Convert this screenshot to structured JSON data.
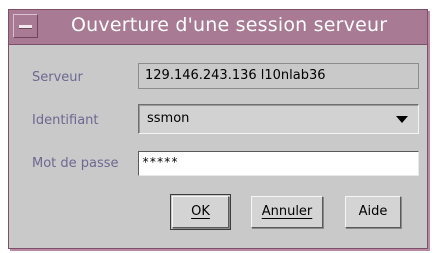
{
  "dialog": {
    "title": "Ouverture d'une session serveur"
  },
  "form": {
    "server_label": "Serveur",
    "server_value": "129.146.243.136 l10nlab36",
    "id_label": "Identifiant",
    "id_value": "ssmon",
    "password_label": "Mot de passe",
    "password_value": "*****"
  },
  "buttons": {
    "ok": "OK",
    "cancel": "Annuler",
    "help": "Aide"
  },
  "colors": {
    "title_bar": "#a87a94",
    "dialog_background": "#c9c9c9",
    "label_text": "#6d6891"
  }
}
